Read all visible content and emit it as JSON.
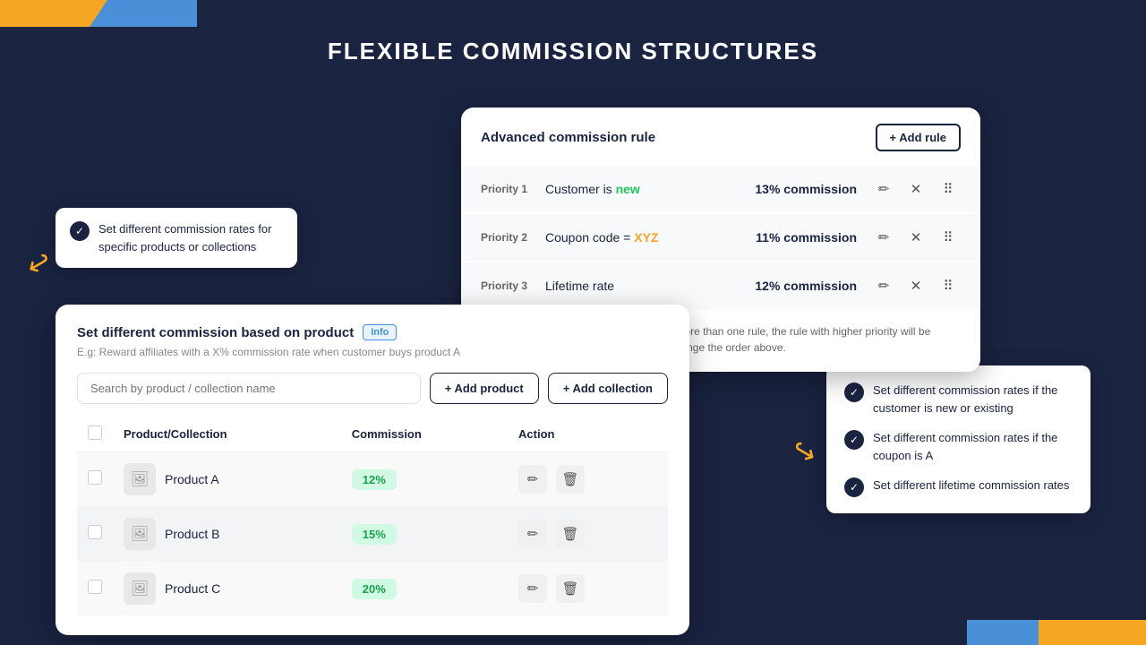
{
  "page": {
    "title": "FLEXIBLE COMMISSION STRUCTURES",
    "bg_color": "#1a2340"
  },
  "left_tooltip": {
    "text": "Set different commission rates for specific products or collections"
  },
  "right_tooltip": {
    "items": [
      "Set different commission rates if the customer is new or existing",
      "Set different commission rates if the coupon is A",
      "Set different lifetime commission rates"
    ]
  },
  "adv_card": {
    "title": "Advanced commission rule",
    "add_rule_label": "+ Add rule",
    "priorities": [
      {
        "label": "Priority 1",
        "condition_prefix": "Customer is ",
        "condition_highlight": "new",
        "highlight_class": "highlight-new",
        "commission": "13% commission"
      },
      {
        "label": "Priority 2",
        "condition_prefix": "Coupon code = ",
        "condition_highlight": "XYZ",
        "highlight_class": "highlight-xyz",
        "commission": "11% commission"
      },
      {
        "label": "Priority 3",
        "condition_prefix": "Lifetime rate",
        "condition_highlight": "",
        "highlight_class": "",
        "commission": "12% commission"
      }
    ],
    "info_text": "If an order satisfies the condition of more than one rule, the rule with higher priority will be applied. You can set priority by re-arrange the order above."
  },
  "product_card": {
    "title": "Set different commission based on product",
    "info_badge": "Info",
    "subtitle": "E.g: Reward affiliates with a X% commission rate when customer buys product A",
    "search_placeholder": "Search by product / collection name",
    "add_product_label": "+ Add product",
    "add_collection_label": "+ Add collection",
    "table": {
      "headers": [
        "Product/Collection",
        "Commission",
        "Action"
      ],
      "rows": [
        {
          "name": "Product A",
          "commission": "12%"
        },
        {
          "name": "Product B",
          "commission": "15%"
        },
        {
          "name": "Product C",
          "commission": "20%"
        }
      ]
    }
  }
}
